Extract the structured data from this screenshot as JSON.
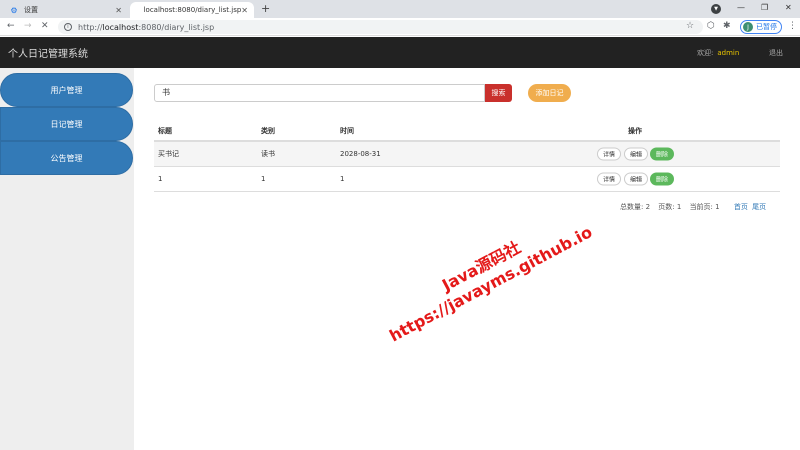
{
  "browser": {
    "tabs": [
      {
        "label": "设置",
        "icon": "gear-icon"
      },
      {
        "label": "localhost:8080/diary_list.jsp",
        "icon": "page-icon"
      }
    ],
    "url_prefix": "http://",
    "url_host": "localhost",
    "url_rest": ":8080/diary_list.jsp",
    "profile_label": "已暂停",
    "profile_initial": "J"
  },
  "header": {
    "title": "个人日记管理系统",
    "welcome_label": "欢迎:",
    "username": "admin",
    "logout_label": "退出"
  },
  "sidebar": {
    "items": [
      {
        "label": "用户管理"
      },
      {
        "label": "日记管理"
      },
      {
        "label": "公告管理"
      }
    ]
  },
  "search": {
    "value": "书",
    "button_label": "搜索",
    "add_label": "添加日记"
  },
  "table": {
    "headers": {
      "title": "标题",
      "type": "类别",
      "time": "时间",
      "ops": "操作"
    },
    "rows": [
      {
        "title": "买书记",
        "type": "读书",
        "time": "2028-08-31"
      },
      {
        "title": "1",
        "type": "1",
        "time": "1"
      }
    ],
    "op_labels": {
      "detail": "详情",
      "edit": "编辑",
      "delete": "删除"
    }
  },
  "pagination": {
    "total_label": "总数量: 2",
    "pages_label": "页数: 1",
    "current_label": "当前页: 1",
    "first_label": "首页",
    "last_label": "尾页"
  },
  "watermark": {
    "line1": "Java源码社",
    "line2": "https://javayms.github.io"
  },
  "colors": {
    "header_bg": "#222222",
    "sidebar_item": "#337ab7",
    "search_button": "#c9302c",
    "add_button": "#f0ad4e",
    "delete_button": "#5cb85c",
    "watermark": "#e41919"
  }
}
